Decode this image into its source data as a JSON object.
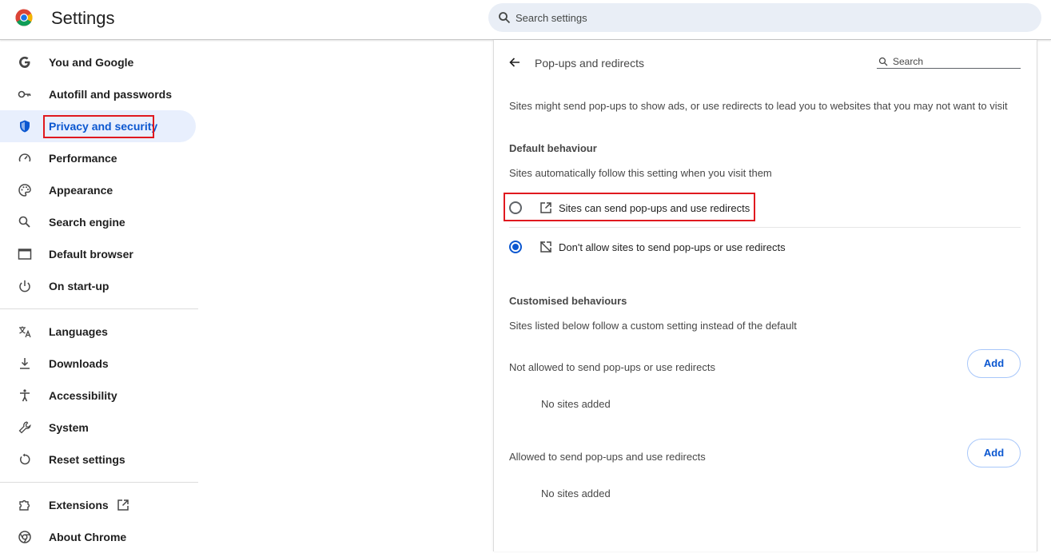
{
  "header": {
    "app_title": "Settings",
    "search_placeholder": "Search settings",
    "logo_icon": "chrome-logo-icon"
  },
  "sidebar": {
    "items": [
      {
        "label": "You and Google",
        "icon": "google-icon"
      },
      {
        "label": "Autofill and passwords",
        "icon": "key-icon"
      },
      {
        "label": "Privacy and security",
        "icon": "shield-icon",
        "active": true
      },
      {
        "label": "Performance",
        "icon": "gauge-icon"
      },
      {
        "label": "Appearance",
        "icon": "palette-icon"
      },
      {
        "label": "Search engine",
        "icon": "search-icon"
      },
      {
        "label": "Default browser",
        "icon": "browser-window-icon"
      },
      {
        "label": "On start-up",
        "icon": "power-icon"
      },
      {
        "label": "Languages",
        "icon": "translate-icon"
      },
      {
        "label": "Downloads",
        "icon": "download-icon"
      },
      {
        "label": "Accessibility",
        "icon": "accessibility-icon"
      },
      {
        "label": "System",
        "icon": "wrench-icon"
      },
      {
        "label": "Reset settings",
        "icon": "reset-icon"
      },
      {
        "label": "Extensions",
        "icon": "puzzle-icon"
      },
      {
        "label": "About Chrome",
        "icon": "chrome-icon"
      }
    ]
  },
  "page": {
    "title": "Pop-ups and redirects",
    "search_placeholder": "Search",
    "description": "Sites might send pop-ups to show ads, or use redirects to lead you to websites that you may not want to visit",
    "default_heading": "Default behaviour",
    "default_subtext": "Sites automatically follow this setting when you visit them",
    "options": [
      {
        "label": "Sites can send pop-ups and use redirects",
        "icon": "open-in-new-icon",
        "selected": false
      },
      {
        "label": "Don't allow sites to send pop-ups or use redirects",
        "icon": "block-popup-icon",
        "selected": true
      }
    ],
    "custom_heading": "Customised behaviours",
    "custom_subtext": "Sites listed below follow a custom setting instead of the default",
    "not_allowed": {
      "label": "Not allowed to send pop-ups or use redirects",
      "button": "Add",
      "empty": "No sites added"
    },
    "allowed": {
      "label": "Allowed to send pop-ups and use redirects",
      "button": "Add",
      "empty": "No sites added"
    }
  },
  "colors": {
    "accent": "#0b57d0",
    "highlight": "#e0191f",
    "active_bg": "#e8effd"
  }
}
